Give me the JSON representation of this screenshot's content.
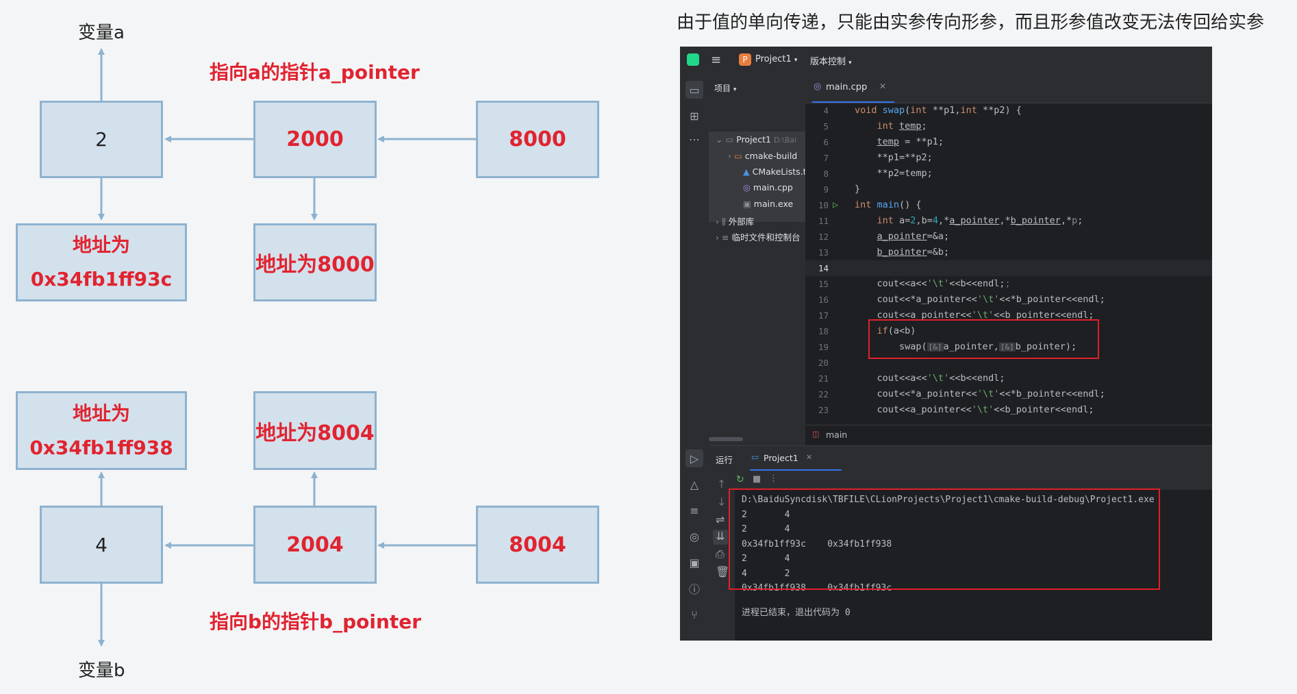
{
  "diagram": {
    "caption": "由于值的单向传递，只能由实参传向形参，而且形参值改变无法传回给实参",
    "top": {
      "var_label": "变量a",
      "value": "2",
      "pointer_value": "2000",
      "pp_value": "8000",
      "addr_line1": "地址为",
      "addr_line2": "0x34fb1ff93c",
      "pointer_addr": "地址为8000",
      "pointer_label": "指向a的指针a_pointer"
    },
    "bottom": {
      "var_label": "变量b",
      "value": "4",
      "pointer_value": "2004",
      "pp_value": "8004",
      "addr_line1": "地址为",
      "addr_line2": "0x34fb1ff938",
      "pointer_addr": "地址为8004",
      "pointer_label": "指向b的指针b_pointer"
    }
  },
  "ide": {
    "project_badge": "P",
    "project_name": "Project1",
    "vcs": "版本控制",
    "panel_title": "项目",
    "tree": [
      {
        "label": "Project1",
        "suffix": "D:\\Bai"
      },
      {
        "label": "cmake-build"
      },
      {
        "label": "CMakeLists.t"
      },
      {
        "label": "main.cpp"
      },
      {
        "label": "main.exe"
      },
      {
        "label": "外部库"
      },
      {
        "label": "临时文件和控制台"
      }
    ],
    "tab": "main.cpp",
    "breadcrumb": "main",
    "code": [
      {
        "n": "4"
      },
      {
        "n": "5"
      },
      {
        "n": "6"
      },
      {
        "n": "7"
      },
      {
        "n": "8"
      },
      {
        "n": "9"
      },
      {
        "n": "10"
      },
      {
        "n": "11"
      },
      {
        "n": "12"
      },
      {
        "n": "13"
      },
      {
        "n": "14"
      },
      {
        "n": "15"
      },
      {
        "n": "16"
      },
      {
        "n": "17"
      },
      {
        "n": "18"
      },
      {
        "n": "19"
      },
      {
        "n": "20"
      },
      {
        "n": "21"
      },
      {
        "n": "22"
      },
      {
        "n": "23"
      }
    ],
    "run": {
      "title": "运行",
      "tab": "Project1",
      "output": [
        "D:\\BaiduSyncdisk\\TBFILE\\CLionProjects\\Project1\\cmake-build-debug\\Project1.exe",
        "2       4",
        "2       4",
        "0x34fb1ff93c    0x34fb1ff938",
        "2       4",
        "4       2",
        "0x34fb1ff938    0x34fb1ff93c"
      ],
      "exit_msg": "进程已结束，退出代码为 0"
    }
  }
}
